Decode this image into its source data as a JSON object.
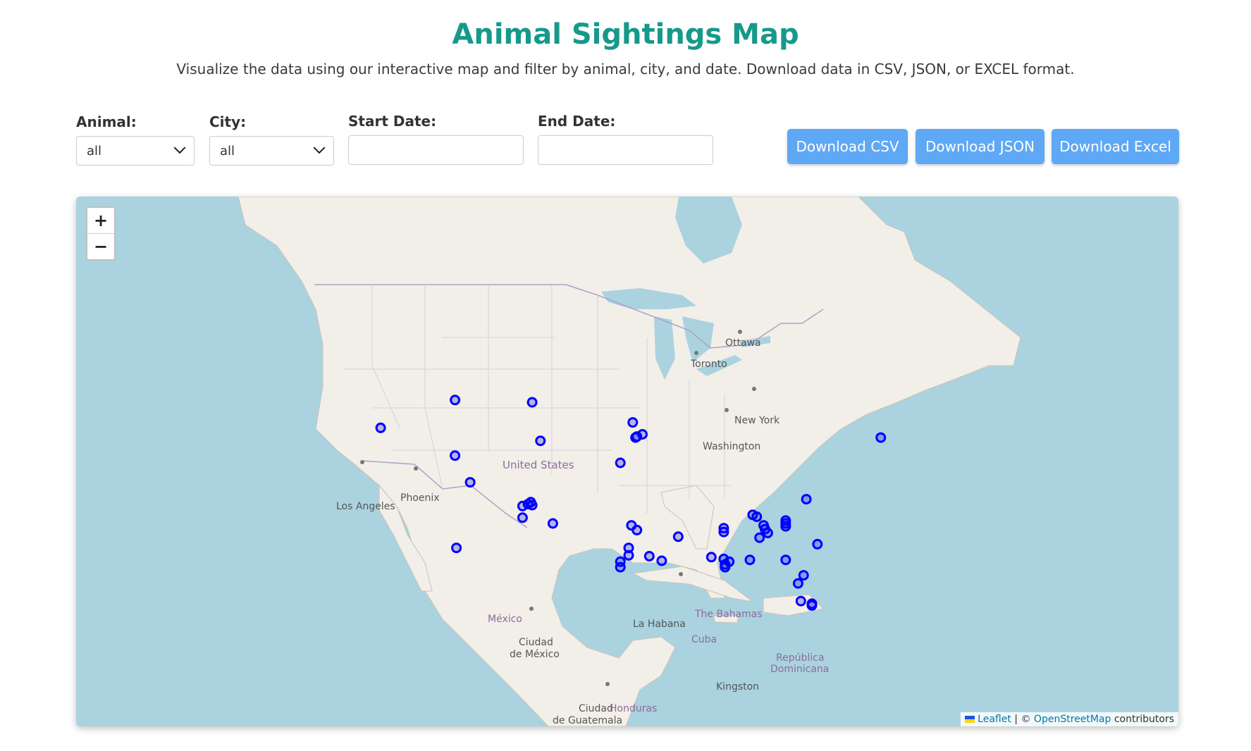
{
  "header": {
    "title": "Animal Sightings Map",
    "subtitle": "Visualize the data using our interactive map and filter by animal, city, and date. Download data in CSV, JSON, or EXCEL format."
  },
  "filters": {
    "animal": {
      "label": "Animal:",
      "value": "all"
    },
    "city": {
      "label": "City:",
      "value": "all"
    },
    "start_date": {
      "label": "Start Date:",
      "value": ""
    },
    "end_date": {
      "label": "End Date:",
      "value": ""
    }
  },
  "buttons": {
    "csv": "Download CSV",
    "json": "Download JSON",
    "excel": "Download Excel"
  },
  "map": {
    "zoom_in": "+",
    "zoom_out": "−",
    "labels": {
      "ottawa": "Ottawa",
      "toronto": "Toronto",
      "new_york": "New York",
      "washington": "Washington",
      "united_states": "United States",
      "phoenix": "Phoenix",
      "los_angeles": "Los Angeles",
      "mexico": "México",
      "ciudad_de": "Ciudad",
      "mexico_city": "de México",
      "la_habana": "La Habana",
      "bahamas": "The Bahamas",
      "cuba": "Cuba",
      "republica": "República",
      "dominicana": "Dominicana",
      "kingston": "Kingston",
      "guatemala_1": "Ciudad",
      "guatemala_2": "de Guatemala",
      "honduras": "Honduras"
    },
    "attribution": {
      "leaflet": "Leaflet",
      "separator": "| ©",
      "osm": "OpenStreetMap",
      "contributors": "contributors"
    },
    "marker_color": "#0000ff",
    "sightings": [
      {
        "lat": 45.9,
        "lon": -104.5
      },
      {
        "lat": 45.7,
        "lon": -98.9
      },
      {
        "lat": 43.4,
        "lon": -109.9
      },
      {
        "lat": 42.2,
        "lon": -98.3
      },
      {
        "lat": 40.8,
        "lon": -104.5
      },
      {
        "lat": 38.2,
        "lon": -103.4
      },
      {
        "lat": 36.2,
        "lon": -99.0
      },
      {
        "lat": 36.0,
        "lon": -99.2
      },
      {
        "lat": 35.8,
        "lon": -99.6
      },
      {
        "lat": 35.9,
        "lon": -98.9
      },
      {
        "lat": 34.6,
        "lon": -99.6
      },
      {
        "lat": 34.0,
        "lon": -97.4
      },
      {
        "lat": 31.4,
        "lon": -104.4
      },
      {
        "lat": 43.9,
        "lon": -91.6
      },
      {
        "lat": 42.8,
        "lon": -90.9
      },
      {
        "lat": 42.6,
        "lon": -91.3
      },
      {
        "lat": 42.5,
        "lon": -91.4
      },
      {
        "lat": 40.1,
        "lon": -92.5
      },
      {
        "lat": 33.8,
        "lon": -91.7
      },
      {
        "lat": 33.3,
        "lon": -91.3
      },
      {
        "lat": 32.6,
        "lon": -88.3
      },
      {
        "lat": 31.4,
        "lon": -91.9
      },
      {
        "lat": 30.6,
        "lon": -91.9
      },
      {
        "lat": 29.9,
        "lon": -92.5
      },
      {
        "lat": 29.3,
        "lon": -92.5
      },
      {
        "lat": 30.5,
        "lon": -90.4
      },
      {
        "lat": 30.0,
        "lon": -89.5
      },
      {
        "lat": 30.4,
        "lon": -85.9
      },
      {
        "lat": 30.2,
        "lon": -85.0
      },
      {
        "lat": 29.6,
        "lon": -84.9
      },
      {
        "lat": 29.9,
        "lon": -84.6
      },
      {
        "lat": 29.3,
        "lon": -84.9
      },
      {
        "lat": 30.1,
        "lon": -83.1
      },
      {
        "lat": 33.5,
        "lon": -85.0
      },
      {
        "lat": 33.1,
        "lon": -85.0
      },
      {
        "lat": 34.9,
        "lon": -82.9
      },
      {
        "lat": 34.7,
        "lon": -82.6
      },
      {
        "lat": 33.8,
        "lon": -82.1
      },
      {
        "lat": 33.4,
        "lon": -82.0
      },
      {
        "lat": 33.0,
        "lon": -81.8
      },
      {
        "lat": 32.5,
        "lon": -82.4
      },
      {
        "lat": 34.3,
        "lon": -80.5
      },
      {
        "lat": 34.0,
        "lon": -80.5
      },
      {
        "lat": 33.7,
        "lon": -80.5
      },
      {
        "lat": 30.1,
        "lon": -80.5
      },
      {
        "lat": 31.8,
        "lon": -78.2
      },
      {
        "lat": 36.5,
        "lon": -79.0
      },
      {
        "lat": 28.4,
        "lon": -79.2
      },
      {
        "lat": 27.5,
        "lon": -79.6
      },
      {
        "lat": 25.5,
        "lon": -79.4
      },
      {
        "lat": 25.2,
        "lon": -78.6
      },
      {
        "lat": 25.0,
        "lon": -78.6
      },
      {
        "lat": 42.5,
        "lon": -73.6
      }
    ]
  }
}
